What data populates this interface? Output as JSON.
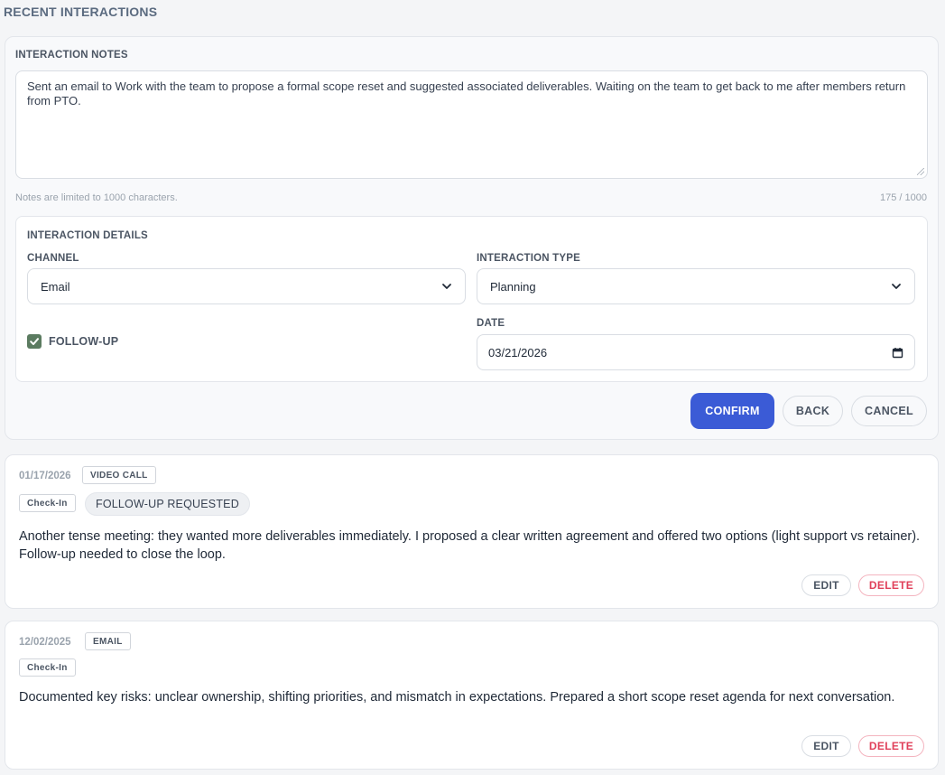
{
  "section_title": "RECENT INTERACTIONS",
  "editor": {
    "notes_label": "INTERACTION NOTES",
    "notes_value": "Sent an email to Work with the team to propose a formal scope reset and suggested associated deliverables. Waiting on the team to get back to me after members return from PTO.",
    "limit_hint": "Notes are limited to 1000 characters.",
    "char_count": "175 / 1000",
    "details": {
      "title": "INTERACTION DETAILS",
      "channel_label": "CHANNEL",
      "channel_value": "Email",
      "type_label": "INTERACTION TYPE",
      "type_value": "Planning",
      "followup_label": "FOLLOW-UP",
      "followup_checked": true,
      "date_label": "DATE",
      "date_value": "03/21/2026"
    },
    "buttons": {
      "confirm": "CONFIRM",
      "back": "BACK",
      "cancel": "CANCEL"
    }
  },
  "entries": [
    {
      "date": "01/17/2026",
      "channel": "VIDEO CALL",
      "type": "Check-In",
      "followup_badge": "FOLLOW-UP REQUESTED",
      "text": "Another tense meeting: they wanted more deliverables immediately. I proposed a clear written agreement and offered two options (light support vs retainer). Follow-up needed to close the loop.",
      "edit": "EDIT",
      "delete": "DELETE"
    },
    {
      "date": "12/02/2025",
      "channel": "EMAIL",
      "type": "Check-In",
      "text": "Documented key risks: unclear ownership, shifting priorities, and mismatch in expectations. Prepared a short scope reset agenda for next conversation.",
      "edit": "EDIT",
      "delete": "DELETE"
    }
  ],
  "colors": {
    "primary": "#3b5bd6",
    "checkbox": "#5b7b60",
    "danger": "#e0405a"
  },
  "icons": {
    "select": "chevron-down-icon",
    "date": "calendar-icon",
    "checkbox": "check-icon"
  }
}
